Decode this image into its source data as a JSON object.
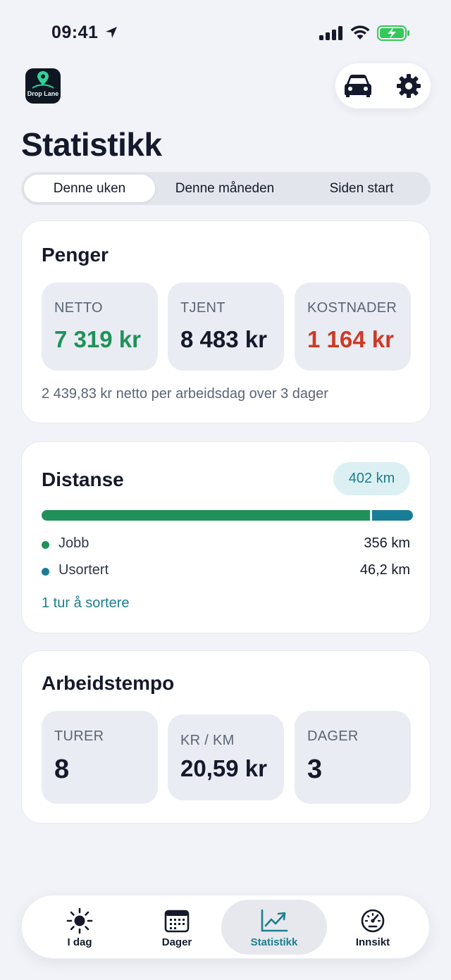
{
  "status_bar": {
    "time": "09:41"
  },
  "app": {
    "logo_text": "Drop Lane"
  },
  "header": {
    "title": "Statistikk"
  },
  "period_tabs": [
    {
      "label": "Denne uken",
      "selected": true
    },
    {
      "label": "Denne måneden",
      "selected": false
    },
    {
      "label": "Siden start",
      "selected": false
    }
  ],
  "money": {
    "title": "Penger",
    "tiles": [
      {
        "label": "NETTO",
        "value": "7 319 kr"
      },
      {
        "label": "TJENT",
        "value": "8 483 kr"
      },
      {
        "label": "KOSTNADER",
        "value": "1 164 kr"
      }
    ],
    "note": "2 439,83 kr netto per arbeidsdag over 3 dager"
  },
  "distance": {
    "title": "Distanse",
    "total": "402 km",
    "work_share": 0.885,
    "legend": [
      {
        "label": "Jobb",
        "value": "356 km",
        "color": "#20915a"
      },
      {
        "label": "Usortert",
        "value": "46,2 km",
        "color": "#1a7d96"
      }
    ],
    "sort_link": "1 tur å sortere"
  },
  "tempo": {
    "title": "Arbeidstempo",
    "tiles": [
      {
        "label": "TURER",
        "value": "8"
      },
      {
        "label": "KR / KM",
        "value": "20,59 kr"
      },
      {
        "label": "DAGER",
        "value": "3"
      }
    ]
  },
  "colors": {
    "accent": "#1d7f8c",
    "positive": "#20915a",
    "negative": "#cc3a26"
  },
  "tabbar": [
    {
      "label": "I dag",
      "icon": "sun-icon",
      "active": false
    },
    {
      "label": "Dager",
      "icon": "calendar-icon",
      "active": false
    },
    {
      "label": "Statistikk",
      "icon": "chart-icon",
      "active": true
    },
    {
      "label": "Innsikt",
      "icon": "gauge-icon",
      "active": false
    }
  ]
}
